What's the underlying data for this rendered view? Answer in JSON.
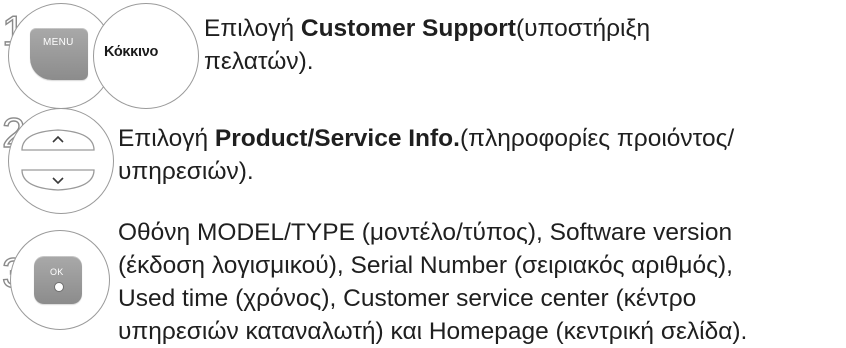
{
  "steps": [
    {
      "number": "1",
      "keys": {
        "menu_label": "MENU",
        "red_label": "Κόκκινο"
      },
      "text_prefix": "Επιλογή ",
      "text_bold": "Customer Support",
      "text_suffix": "(υποστήριξη πελατών)."
    },
    {
      "number": "2",
      "keys": {
        "up_label": "^",
        "down_label": "⌄"
      },
      "text_prefix": "Επιλογή ",
      "text_bold": "Product/Service Info.",
      "text_suffix": "(πληροφορίες προιόντος/ υπηρεσιών)."
    },
    {
      "number": "3",
      "keys": {
        "ok_label": "OK"
      },
      "text_lines": [
        "Οθόνη MODEL/TYPE (μοντέλο/τύπος), Software version",
        "(έκδοση λογισμικού), Serial Number (σειριακός αριθμός),",
        "Used time (χρόνος), Customer service center (κέντρο",
        "υπηρεσιών καταναλωτή) και Homepage (κεντρική σελίδα)."
      ]
    }
  ]
}
